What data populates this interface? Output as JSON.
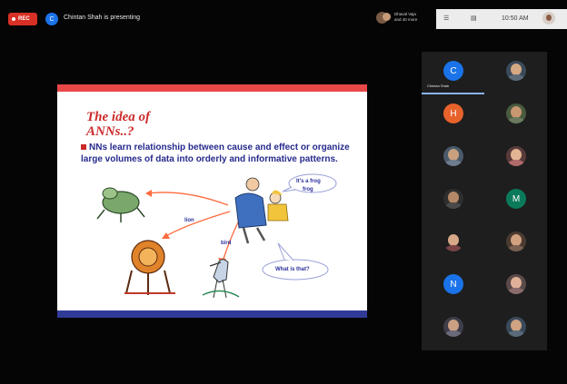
{
  "top_bar": {
    "rec_label": "REC",
    "presenter_initial": "C",
    "presenting_text": "Chintan Shah is presenting",
    "viewers_line1": "Dhaval Vaja",
    "viewers_line2": "and 40 more",
    "clock": "10:50 AM"
  },
  "slide": {
    "title_line1": "The idea of",
    "title_line2": "ANNs..?",
    "bullet": "NNs learn relationship between cause and effect or organize large volumes of data into orderly and informative patterns.",
    "labels": {
      "frog": "It's a frog",
      "frog2": "frog",
      "lion": "lion",
      "bird": "bird",
      "question": "What is that?"
    }
  },
  "participants": {
    "speaker_name": "Chintan Shah",
    "tiles": [
      {
        "initial": "C",
        "color": "#1a73e8"
      },
      {
        "initial": "",
        "color": "#5d6b7a"
      },
      {
        "initial": "H",
        "color": "#e8622c"
      },
      {
        "initial": "",
        "color": "#6a7a5e"
      },
      {
        "initial": "",
        "color": "#6e7c8e"
      },
      {
        "initial": "",
        "color": "#b06a6a"
      },
      {
        "initial": "",
        "color": "#4a4a4a"
      },
      {
        "initial": "M",
        "color": "#0b7a5a"
      },
      {
        "initial": "",
        "color": "#7a4444"
      },
      {
        "initial": "",
        "color": "#7a6050"
      },
      {
        "initial": "N",
        "color": "#1a73e8"
      },
      {
        "initial": "",
        "color": "#8a6a6a"
      },
      {
        "initial": "",
        "color": "#6a6a7a"
      },
      {
        "initial": "",
        "color": "#5a6a7a"
      }
    ]
  }
}
